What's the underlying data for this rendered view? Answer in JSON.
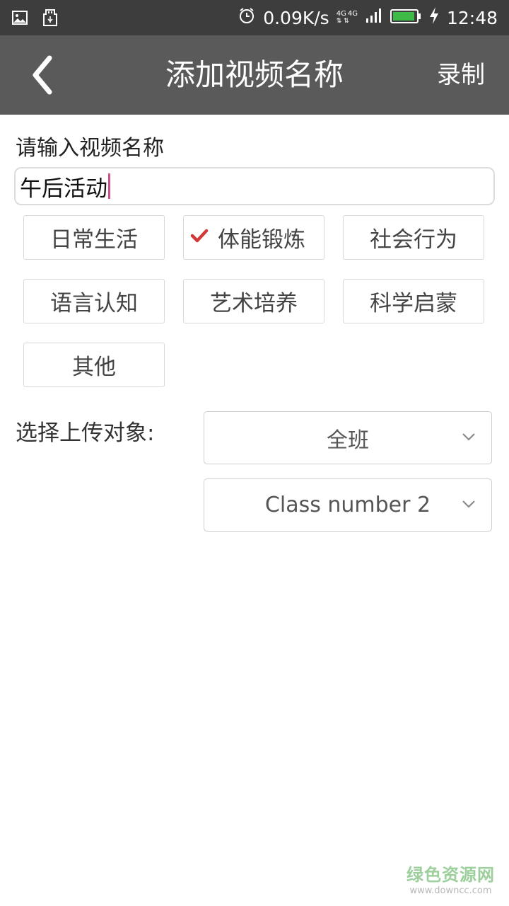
{
  "status_bar": {
    "network_speed": "0.09K/s",
    "network_type_1": "4G",
    "network_type_2": "4G",
    "time": "12:48",
    "icons": [
      "image-icon",
      "usb-icon",
      "alarm-icon",
      "signal-icon",
      "battery-icon",
      "charging-icon"
    ]
  },
  "header": {
    "title": "添加视频名称",
    "record_label": "录制",
    "back_icon": "chevron-left-icon"
  },
  "form": {
    "name_label": "请输入视频名称",
    "name_value": "午后活动",
    "tags": [
      {
        "label": "日常生活",
        "selected": false
      },
      {
        "label": "体能锻炼",
        "selected": true
      },
      {
        "label": "社会行为",
        "selected": false
      },
      {
        "label": "语言认知",
        "selected": false
      },
      {
        "label": "艺术培养",
        "selected": false
      },
      {
        "label": "科学启蒙",
        "selected": false
      },
      {
        "label": "其他",
        "selected": false
      }
    ],
    "target_label": "选择上传对象:",
    "target_scope": "全班",
    "target_class": "Class number 2"
  },
  "colors": {
    "status_bar_bg": "#3d3d3d",
    "title_bar_bg": "#5a5a5a",
    "check_color": "#d23a3a",
    "caret_color": "#d0508a"
  },
  "watermark": {
    "main": "绿色资源网",
    "sub": "www.downcc.com"
  }
}
